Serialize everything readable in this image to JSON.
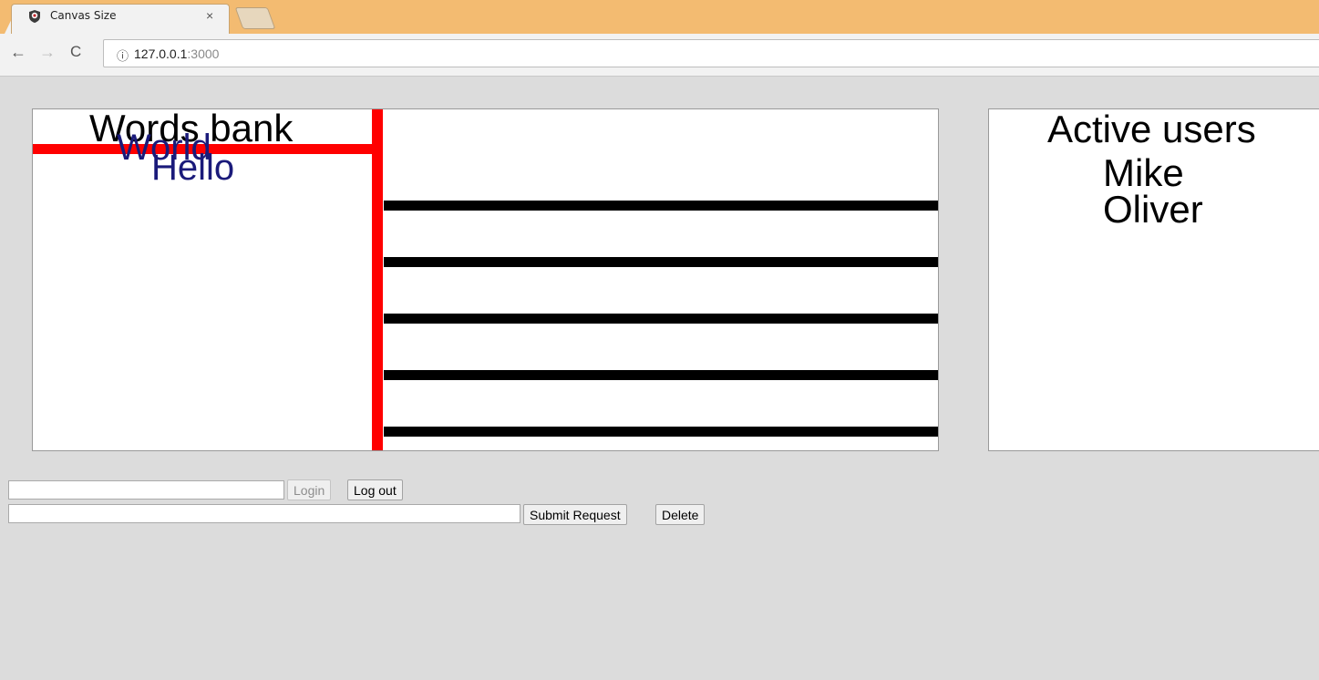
{
  "browser": {
    "tab_title": "Canvas Size",
    "tab_close": "×",
    "url_host": "127.0.0.1",
    "url_port": ":3000"
  },
  "words_bank": {
    "title": "Words bank",
    "words": [
      "World",
      "Hello"
    ],
    "word_color": "#1a1a7a"
  },
  "active_users": {
    "title": "Active users",
    "users": [
      "Mike",
      "Oliver"
    ]
  },
  "colors": {
    "divider": "#ff0000",
    "lines": "#000000"
  },
  "form": {
    "login_input_value": "",
    "login_label": "Login",
    "logout_label": "Log out",
    "request_input_value": "",
    "submit_label": "Submit Request",
    "delete_label": "Delete"
  }
}
